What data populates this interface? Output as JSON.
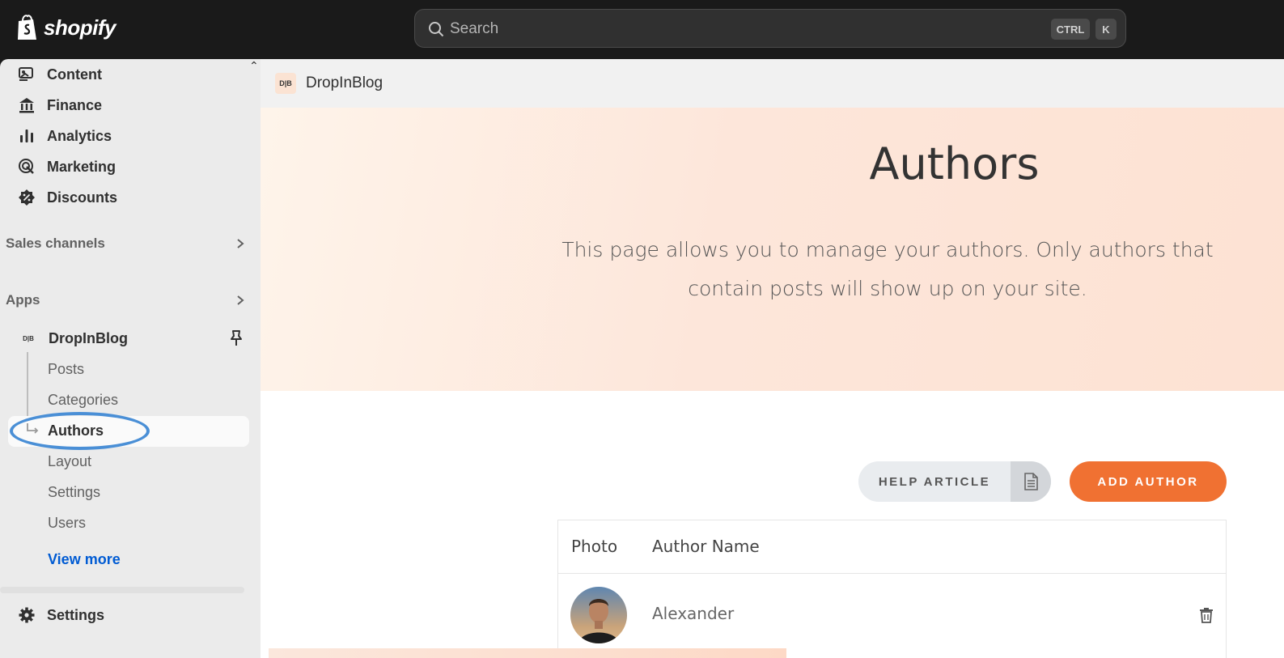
{
  "topbar": {
    "logo_text": "shopify",
    "search_placeholder": "Search",
    "shortcut_ctrl": "CTRL",
    "shortcut_key": "K"
  },
  "sidebar": {
    "nav": [
      {
        "label": "Content",
        "icon": "content-icon"
      },
      {
        "label": "Finance",
        "icon": "bank-icon"
      },
      {
        "label": "Analytics",
        "icon": "bar-chart-icon"
      },
      {
        "label": "Marketing",
        "icon": "target-icon"
      },
      {
        "label": "Discounts",
        "icon": "discount-badge-icon"
      }
    ],
    "sales_channels": "Sales channels",
    "apps": "Apps",
    "app": {
      "logo_text": "D|B",
      "name": "DropInBlog",
      "sub_items": [
        "Posts",
        "Categories",
        "Authors",
        "Layout",
        "Settings",
        "Users"
      ],
      "active": "Authors"
    },
    "view_more": "View more",
    "settings": "Settings"
  },
  "main": {
    "header_title": "DropInBlog",
    "header_logo_text": "D|B",
    "hero_title": "Authors",
    "hero_desc": "This page allows you to manage your authors. Only authors that contain posts will show up on your site.",
    "help_button": "HELP ARTICLE",
    "add_button": "ADD AUTHOR",
    "table": {
      "headers": [
        "Photo",
        "Author Name"
      ],
      "rows": [
        {
          "name": "Alexander"
        }
      ]
    }
  },
  "colors": {
    "accent": "#f07132",
    "link": "#005bd3",
    "highlight": "#4a8fd6"
  }
}
